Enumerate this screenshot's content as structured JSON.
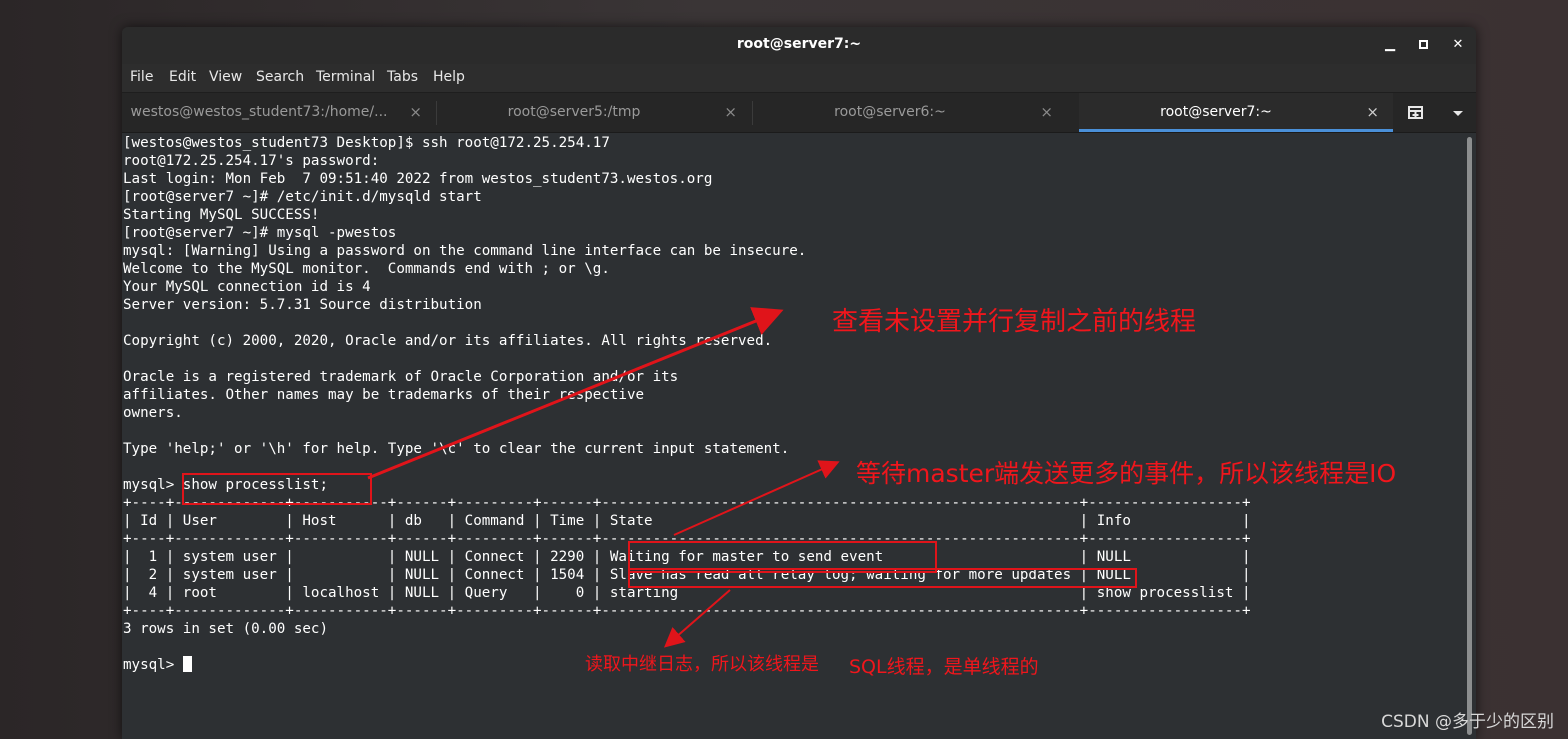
{
  "window": {
    "title": "root@server7:~",
    "controls": {
      "minimize": "▁",
      "maximize": "▫",
      "close": "✕"
    }
  },
  "menu": [
    "File",
    "Edit",
    "View",
    "Search",
    "Terminal",
    "Tabs",
    "Help"
  ],
  "tabs": [
    {
      "label": "westos@westos_student73:/home/...",
      "close": "×",
      "active": false
    },
    {
      "label": "root@server5:/tmp",
      "close": "×",
      "active": false
    },
    {
      "label": "root@server6:~",
      "close": "×",
      "active": false
    },
    {
      "label": "root@server7:~",
      "close": "×",
      "active": true
    }
  ],
  "tab_actions": {
    "new_tab_icon": "new-tab-icon",
    "dropdown_icon": "chevron-down-icon"
  },
  "terminal": {
    "lines": [
      "[westos@westos_student73 Desktop]$ ssh root@172.25.254.17",
      "root@172.25.254.17's password:",
      "Last login: Mon Feb  7 09:51:40 2022 from westos_student73.westos.org",
      "[root@server7 ~]# /etc/init.d/mysqld start",
      "Starting MySQL SUCCESS!",
      "[root@server7 ~]# mysql -pwestos",
      "mysql: [Warning] Using a password on the command line interface can be insecure.",
      "Welcome to the MySQL monitor.  Commands end with ; or \\g.",
      "Your MySQL connection id is 4",
      "Server version: 5.7.31 Source distribution",
      "",
      "Copyright (c) 2000, 2020, Oracle and/or its affiliates. All rights reserved.",
      "",
      "Oracle is a registered trademark of Oracle Corporation and/or its",
      "affiliates. Other names may be trademarks of their respective",
      "owners.",
      "",
      "Type 'help;' or '\\h' for help. Type '\\c' to clear the current input statement.",
      "",
      "mysql> show processlist;",
      "+----+-------------+-----------+------+---------+------+--------------------------------------------------------+------------------+",
      "| Id | User        | Host      | db   | Command | Time | State                                                  | Info             |",
      "+----+-------------+-----------+------+---------+------+--------------------------------------------------------+------------------+",
      "|  1 | system user |           | NULL | Connect | 2290 | Waiting for master to send event                       | NULL             |",
      "|  2 | system user |           | NULL | Connect | 1504 | Slave has read all relay log; waiting for more updates | NULL             |",
      "|  4 | root        | localhost | NULL | Query   |    0 | starting                                               | show processlist |",
      "+----+-------------+-----------+------+---------+------+--------------------------------------------------------+------------------+",
      "3 rows in set (0.00 sec)",
      ""
    ],
    "prompt": "mysql> "
  },
  "annotations": {
    "a1": "查看未设置并行复制之前的线程",
    "a2": "等待master端发送更多的事件，所以该线程是IO",
    "a3_part1": "读取中继日志，所以该线程是",
    "a3_part2": "SQL线程，是单线程的"
  },
  "watermark": "CSDN @多于少的区别",
  "colors": {
    "annotation": "#e0141a",
    "active_tab_underline": "#4a90d9",
    "terminal_bg": "#2d3033"
  }
}
